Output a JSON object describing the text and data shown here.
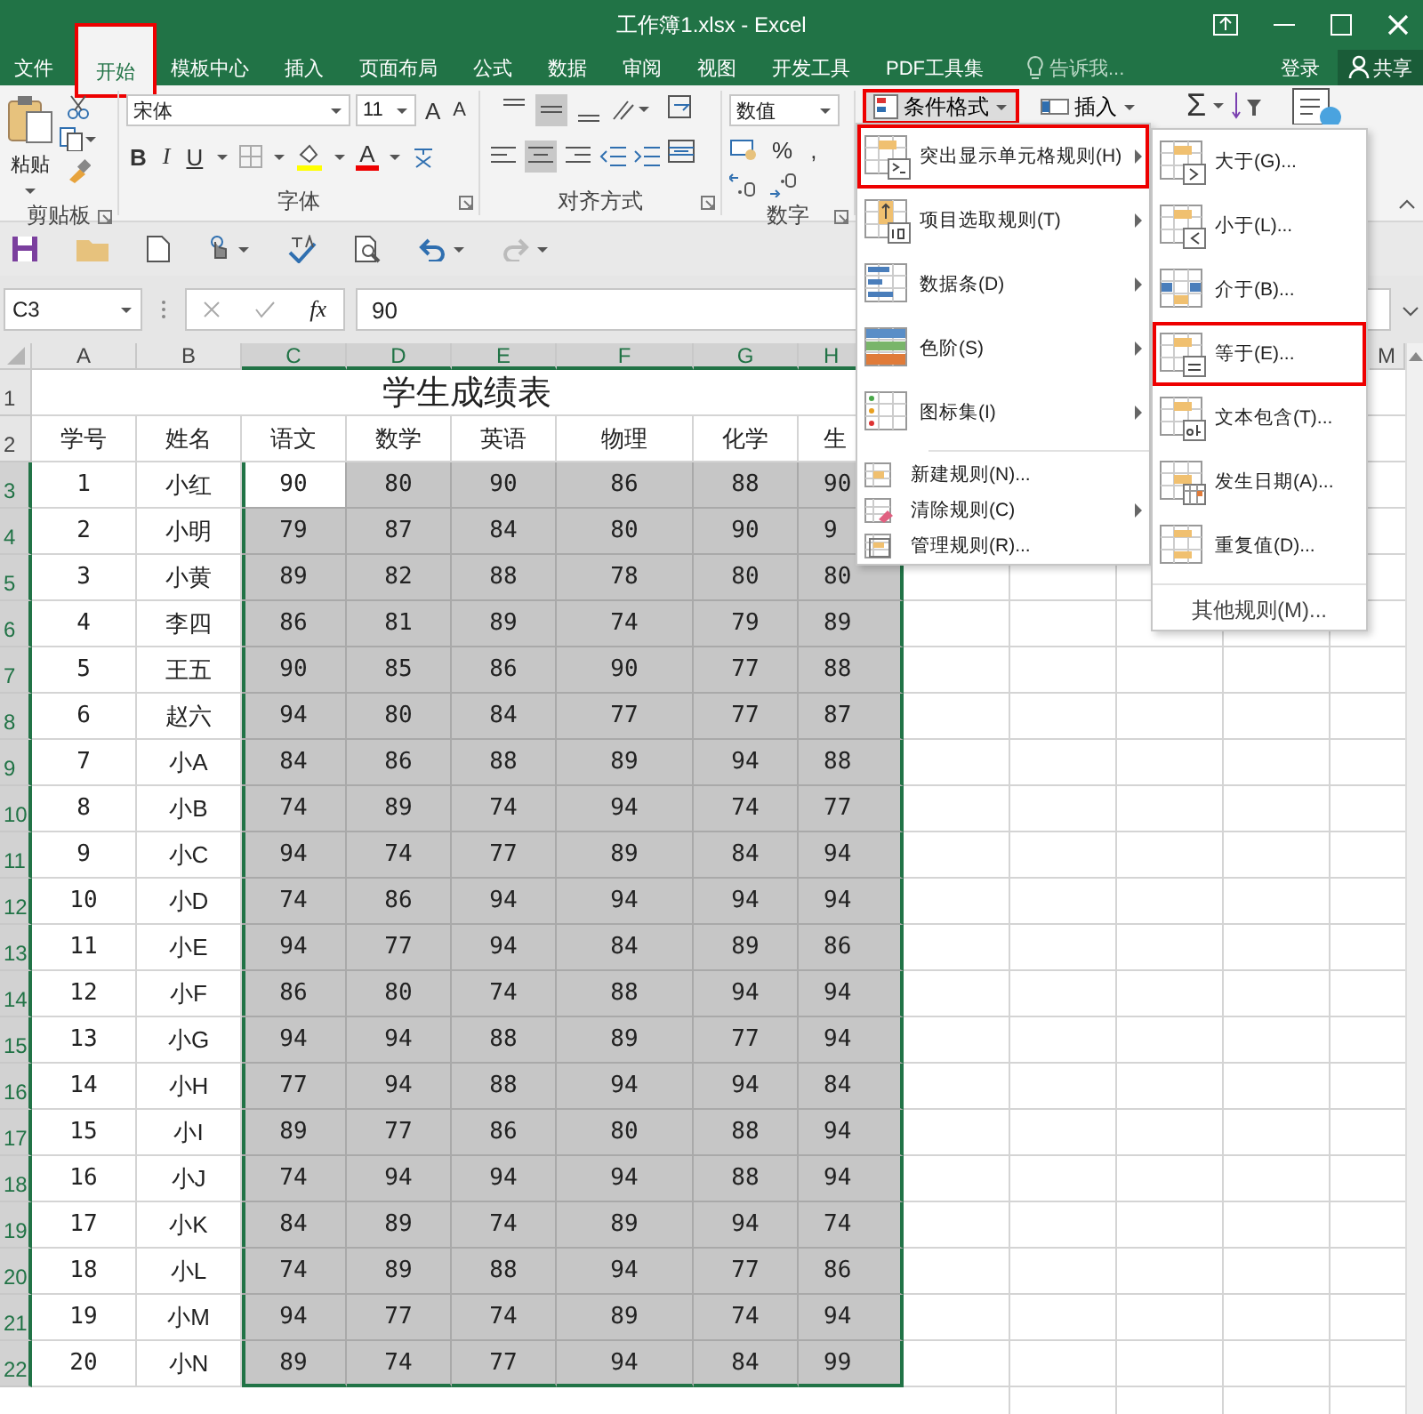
{
  "window": {
    "title": "工作簿1.xlsx - Excel"
  },
  "tabs": [
    {
      "label": "文件",
      "selected": false,
      "annotated": false
    },
    {
      "label": "开始",
      "selected": true,
      "annotated": true
    },
    {
      "label": "模板中心",
      "selected": false,
      "annotated": false
    },
    {
      "label": "插入",
      "selected": false,
      "annotated": false
    },
    {
      "label": "页面布局",
      "selected": false,
      "annotated": false
    },
    {
      "label": "公式",
      "selected": false,
      "annotated": false
    },
    {
      "label": "数据",
      "selected": false,
      "annotated": false
    },
    {
      "label": "审阅",
      "selected": false,
      "annotated": false
    },
    {
      "label": "视图",
      "selected": false,
      "annotated": false
    },
    {
      "label": "开发工具",
      "selected": false,
      "annotated": false
    },
    {
      "label": "PDF工具集",
      "selected": false,
      "annotated": false
    }
  ],
  "tell_me": {
    "placeholder": "告诉我..."
  },
  "sign_in": "登录",
  "share": "共享",
  "ribbon": {
    "clipboard": {
      "paste": "粘贴",
      "label": "剪贴板"
    },
    "font": {
      "family": "宋体",
      "size": "11",
      "grow": "A",
      "shrink": "A",
      "bold": "B",
      "italic": "I",
      "underline": "U",
      "font_color_button": "A",
      "label": "字体"
    },
    "alignment": {
      "label": "对齐方式"
    },
    "number": {
      "format": "数值",
      "percent": "%",
      "comma": ",",
      "label": "数字"
    },
    "conditional_format": {
      "label": "条件格式",
      "annotated": true
    },
    "insert": {
      "label": "插入"
    },
    "sum": "Σ"
  },
  "formula_bar": {
    "name_box": "C3",
    "function_label": "fx",
    "value": "90"
  },
  "sheet": {
    "columns": [
      {
        "label": "A",
        "selected": false
      },
      {
        "label": "B",
        "selected": false
      },
      {
        "label": "C",
        "selected": true
      },
      {
        "label": "D",
        "selected": true
      },
      {
        "label": "E",
        "selected": true
      },
      {
        "label": "F",
        "selected": true
      },
      {
        "label": "G",
        "selected": true
      },
      {
        "label": "H",
        "selected": true
      }
    ],
    "far_column": "M",
    "title_row": {
      "header": "1",
      "title": "学生成绩表"
    },
    "heading_row": {
      "header": "2",
      "cells": [
        "学号",
        "姓名",
        "语文",
        "数学",
        "英语",
        "物理",
        "化学",
        "生"
      ]
    },
    "rows": [
      {
        "header": "3",
        "selected": true,
        "active": true,
        "cells": [
          "1",
          "小红",
          "90",
          "80",
          "90",
          "86",
          "88",
          "90"
        ]
      },
      {
        "header": "4",
        "selected": true,
        "active": false,
        "cells": [
          "2",
          "小明",
          "79",
          "87",
          "84",
          "80",
          "90",
          "9"
        ]
      },
      {
        "header": "5",
        "selected": true,
        "active": false,
        "cells": [
          "3",
          "小黄",
          "89",
          "82",
          "88",
          "78",
          "80",
          "80"
        ]
      },
      {
        "header": "6",
        "selected": true,
        "active": false,
        "cells": [
          "4",
          "李四",
          "86",
          "81",
          "89",
          "74",
          "79",
          "89"
        ]
      },
      {
        "header": "7",
        "selected": true,
        "active": false,
        "cells": [
          "5",
          "王五",
          "90",
          "85",
          "86",
          "90",
          "77",
          "88"
        ]
      },
      {
        "header": "8",
        "selected": true,
        "active": false,
        "cells": [
          "6",
          "赵六",
          "94",
          "80",
          "84",
          "77",
          "77",
          "87"
        ]
      },
      {
        "header": "9",
        "selected": true,
        "active": false,
        "cells": [
          "7",
          "小A",
          "84",
          "86",
          "88",
          "89",
          "94",
          "88"
        ]
      },
      {
        "header": "10",
        "selected": true,
        "active": false,
        "cells": [
          "8",
          "小B",
          "74",
          "89",
          "74",
          "94",
          "74",
          "77"
        ]
      },
      {
        "header": "11",
        "selected": true,
        "active": false,
        "cells": [
          "9",
          "小C",
          "94",
          "74",
          "77",
          "89",
          "84",
          "94"
        ]
      },
      {
        "header": "12",
        "selected": true,
        "active": false,
        "cells": [
          "10",
          "小D",
          "74",
          "86",
          "94",
          "94",
          "94",
          "94"
        ]
      },
      {
        "header": "13",
        "selected": true,
        "active": false,
        "cells": [
          "11",
          "小E",
          "94",
          "77",
          "94",
          "84",
          "89",
          "86"
        ]
      },
      {
        "header": "14",
        "selected": true,
        "active": false,
        "cells": [
          "12",
          "小F",
          "86",
          "80",
          "74",
          "88",
          "94",
          "94"
        ]
      },
      {
        "header": "15",
        "selected": true,
        "active": false,
        "cells": [
          "13",
          "小G",
          "94",
          "94",
          "88",
          "89",
          "77",
          "94"
        ]
      },
      {
        "header": "16",
        "selected": true,
        "active": false,
        "cells": [
          "14",
          "小H",
          "77",
          "94",
          "88",
          "94",
          "94",
          "84"
        ]
      },
      {
        "header": "17",
        "selected": true,
        "active": false,
        "cells": [
          "15",
          "小I",
          "89",
          "77",
          "86",
          "80",
          "88",
          "94"
        ]
      },
      {
        "header": "18",
        "selected": true,
        "active": false,
        "cells": [
          "16",
          "小J",
          "74",
          "94",
          "94",
          "94",
          "88",
          "94"
        ]
      },
      {
        "header": "19",
        "selected": true,
        "active": false,
        "cells": [
          "17",
          "小K",
          "84",
          "89",
          "74",
          "89",
          "94",
          "74"
        ]
      },
      {
        "header": "20",
        "selected": true,
        "active": false,
        "cells": [
          "18",
          "小L",
          "74",
          "89",
          "88",
          "94",
          "77",
          "86"
        ]
      },
      {
        "header": "21",
        "selected": true,
        "active": false,
        "cells": [
          "19",
          "小M",
          "94",
          "77",
          "74",
          "89",
          "74",
          "94"
        ]
      },
      {
        "header": "22",
        "selected": true,
        "active": false,
        "cells": [
          "20",
          "小N",
          "89",
          "74",
          "77",
          "94",
          "84",
          "99"
        ]
      }
    ]
  },
  "conditional_menu": {
    "items": [
      {
        "label": "突出显示单元格规则(H)",
        "kind": "large",
        "submenu": true,
        "annotated": true
      },
      {
        "label": "项目选取规则(T)",
        "kind": "large",
        "submenu": true,
        "annotated": false
      },
      {
        "label": "数据条(D)",
        "kind": "large",
        "submenu": true,
        "annotated": false
      },
      {
        "label": "色阶(S)",
        "kind": "large",
        "submenu": true,
        "annotated": false
      },
      {
        "label": "图标集(I)",
        "kind": "large",
        "submenu": true,
        "annotated": false
      },
      {
        "label": "新建规则(N)...",
        "kind": "small",
        "submenu": false,
        "annotated": false
      },
      {
        "label": "清除规则(C)",
        "kind": "small",
        "submenu": true,
        "annotated": false
      },
      {
        "label": "管理规则(R)...",
        "kind": "small",
        "submenu": false,
        "annotated": false
      }
    ]
  },
  "rules_submenu": {
    "items": [
      {
        "label": "大于(G)...",
        "annotated": false
      },
      {
        "label": "小于(L)...",
        "annotated": false
      },
      {
        "label": "介于(B)...",
        "annotated": false
      },
      {
        "label": "等于(E)...",
        "annotated": true
      },
      {
        "label": "文本包含(T)...",
        "annotated": false
      },
      {
        "label": "发生日期(A)...",
        "annotated": false
      },
      {
        "label": "重复值(D)...",
        "annotated": false
      }
    ],
    "footer": "其他规则(M)..."
  }
}
